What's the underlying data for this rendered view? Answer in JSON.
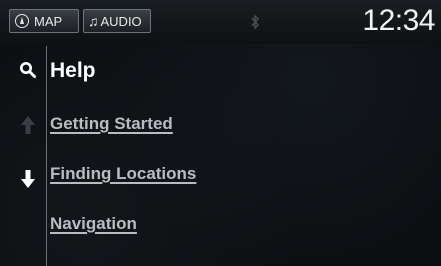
{
  "statusbar": {
    "map_label": "MAP",
    "audio_label": "AUDIO",
    "clock": "12:34",
    "icons": {
      "map": "compass-icon",
      "audio": "music-note-icon",
      "bluetooth": "bluetooth-icon"
    }
  },
  "sidebar": {
    "icons": [
      "search-icon",
      "scroll-up-arrow-icon",
      "scroll-down-arrow-icon"
    ]
  },
  "main": {
    "title": "Help",
    "items": [
      {
        "label": "Getting Started"
      },
      {
        "label": "Finding Locations"
      },
      {
        "label": "Navigation"
      }
    ]
  },
  "colors": {
    "background": "#0c0f12",
    "title_text": "#ffffff",
    "item_text": "#b9bcc0",
    "disabled_icon": "#3a3f44"
  }
}
